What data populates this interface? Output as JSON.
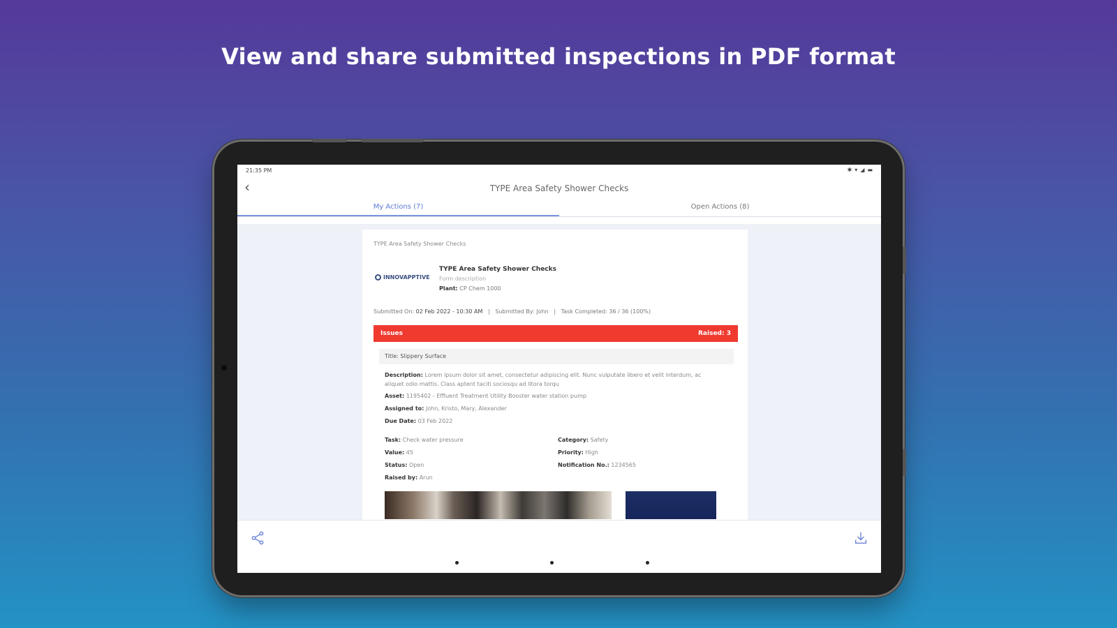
{
  "headline": "View and share submitted inspections in PDF format",
  "status_bar": {
    "time": "21:35 PM"
  },
  "app": {
    "title": "TYPE Area Safety Shower Checks",
    "tabs": [
      {
        "label": "My Actions (7)",
        "active": true
      },
      {
        "label": "Open Actions (8)",
        "active": false
      }
    ]
  },
  "pdf": {
    "header_text": "TYPE Area Safety Shower Checks",
    "logo_text": "INNOVAPPTIVE",
    "form_title": "TYPE Area Safety Shower Checks",
    "form_description": "Form description",
    "plant_label": "Plant:",
    "plant_value": "CP Chem 1000",
    "submitted_on_label": "Submitted On:",
    "submitted_on_value": "02 Feb 2022 - 10:30 AM",
    "submitted_by_label": "Submitted By:",
    "submitted_by_value": "John",
    "task_completed_label": "Task Completed:",
    "task_completed_value": "36 / 36 (100%)",
    "issues_label": "Issues",
    "issues_raised": "Raised: 3",
    "issue": {
      "title_label": "Title:",
      "title_value": "Slippery Surface",
      "description_label": "Description:",
      "description_value": "Lorem ipsum dolor sit amet, consectetur adipiscing elit. Nunc vulputate libero et velit interdum, ac aliquet odio mattis. Class aptent taciti sociosqu ad litora torqu",
      "asset_label": "Asset:",
      "asset_value": "1195402 - Effluent Treatment Utility Booster water station pump",
      "assigned_label": "Assigned to:",
      "assigned_value": "John, Kristo, Mary, Alexander",
      "due_label": "Due Date:",
      "due_value": "03 Feb 2022",
      "task_label": "Task:",
      "task_value": "Check water pressure",
      "value_label": "Value:",
      "value_value": "45",
      "status_label": "Status:",
      "status_value": "Open",
      "raised_label": "Raised by:",
      "raised_value": "Arun",
      "category_label": "Category:",
      "category_value": "Safety",
      "priority_label": "Priority:",
      "priority_value": "High",
      "notification_label": "Notification No.:",
      "notification_value": "1234565"
    }
  },
  "icons": {
    "back": "arrow-left-icon",
    "share": "share-icon",
    "download": "download-icon"
  },
  "colors": {
    "accent": "#5b7bd6",
    "issues_bar": "#f03a30"
  }
}
